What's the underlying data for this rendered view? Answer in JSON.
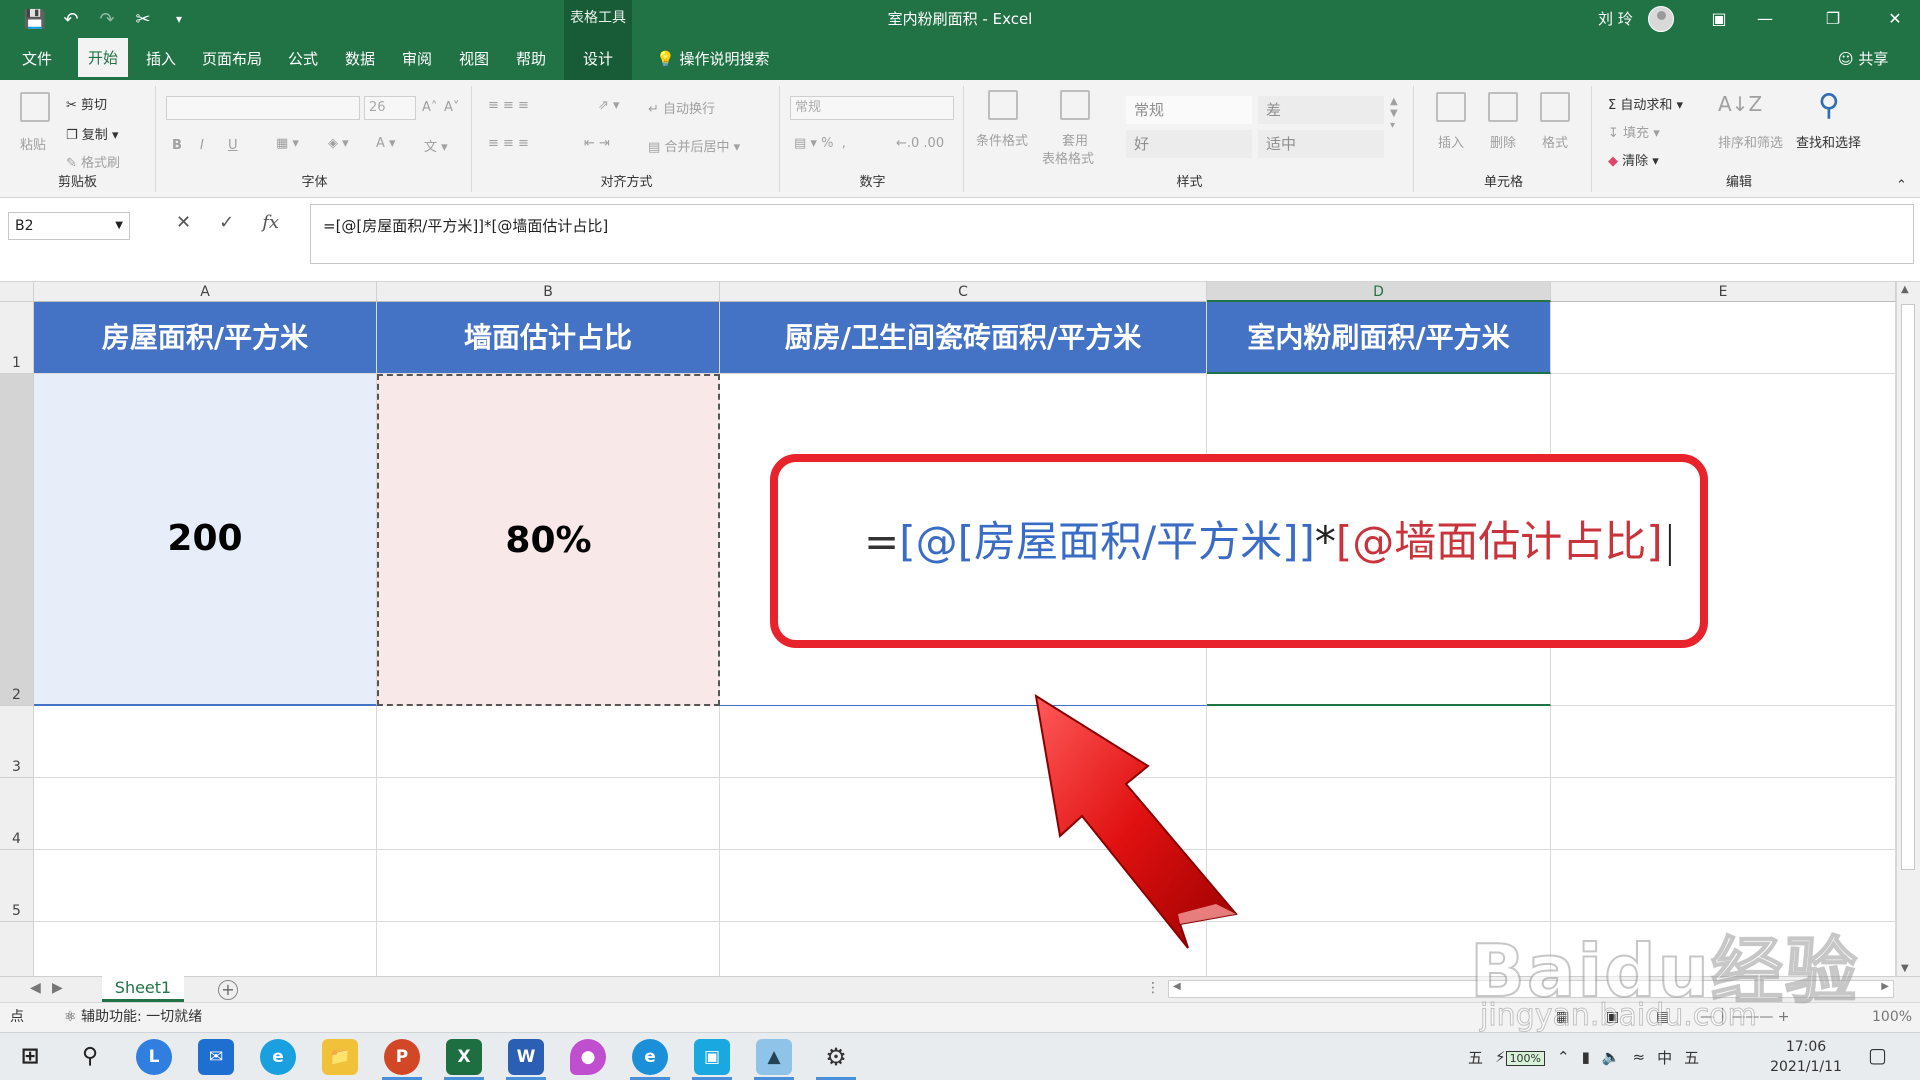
{
  "window": {
    "title": "室内粉刷面积 - Excel",
    "context_tools": "表格工具",
    "user": "刘 玲"
  },
  "tabs": [
    "文件",
    "开始",
    "插入",
    "页面布局",
    "公式",
    "数据",
    "审阅",
    "视图",
    "帮助",
    "设计"
  ],
  "tell_me": "操作说明搜索",
  "share": "共享",
  "ribbon": {
    "clipboard": {
      "paste": "粘贴",
      "cut": "剪切",
      "copy": "复制",
      "format_painter": "格式刷",
      "label": "剪贴板"
    },
    "font": {
      "size": "26",
      "bold": "B",
      "italic": "I",
      "underline": "U",
      "label": "字体"
    },
    "alignment": {
      "wrap": "自动换行",
      "merge": "合并后居中",
      "label": "对齐方式"
    },
    "number": {
      "format": "常规",
      "label": "数字"
    },
    "styles": {
      "conditional": "条件格式",
      "table_format_1": "套用",
      "table_format_2": "表格格式",
      "normal": "常规",
      "bad": "差",
      "good": "好",
      "neutral": "适中",
      "label": "样式"
    },
    "cells": {
      "insert": "插入",
      "delete": "删除",
      "format": "格式",
      "label": "单元格"
    },
    "editing": {
      "autosum": "自动求和",
      "fill": "填充",
      "clear": "清除",
      "sort": "排序和筛选",
      "find": "查找和选择",
      "label": "编辑"
    }
  },
  "formula_bar": {
    "name_box": "B2",
    "formula": "=[@[房屋面积/平方米]]*[@墙面估计占比]"
  },
  "columns": [
    "A",
    "B",
    "C",
    "D",
    "E"
  ],
  "rows": [
    "1",
    "2",
    "3",
    "4",
    "5"
  ],
  "table": {
    "headers": [
      "房屋面积/平方米",
      "墙面估计占比",
      "厨房/卫生间瓷砖面积/平方米",
      "室内粉刷面积/平方米"
    ],
    "row2": [
      "200",
      "80%"
    ]
  },
  "callout": {
    "eq": "=",
    "ref1": "[@[房屋面积/平方米]]",
    "star": "*",
    "ref2": "[@墙面估计占比]"
  },
  "sheets": [
    "Sheet1"
  ],
  "status": {
    "mode": "点",
    "accessibility": "辅助功能: 一切就绪",
    "zoom": "100%"
  },
  "taskbar": {
    "ime": "五",
    "battery": "100%",
    "lang": "中",
    "ime2": "五",
    "time": "17:06",
    "date": "2021/1/11"
  },
  "watermark": {
    "brand": "Baidu经验",
    "url": "jingyan.baidu.com"
  }
}
